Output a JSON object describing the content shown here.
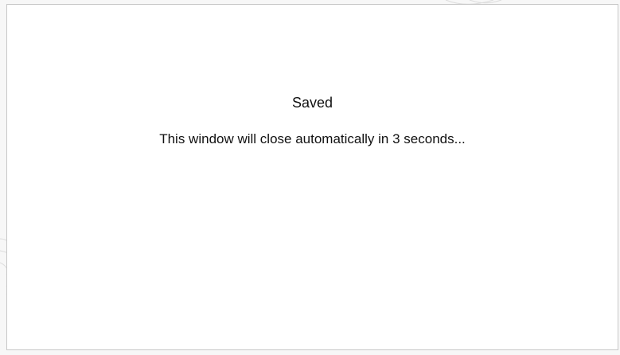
{
  "dialog": {
    "title": "Saved",
    "message": "This window will close automatically in 3 seconds..."
  },
  "colors": {
    "background": "#f7f7f7",
    "dialog_background": "#ffffff",
    "dialog_border": "#c8c8c8",
    "text": "#111111"
  }
}
